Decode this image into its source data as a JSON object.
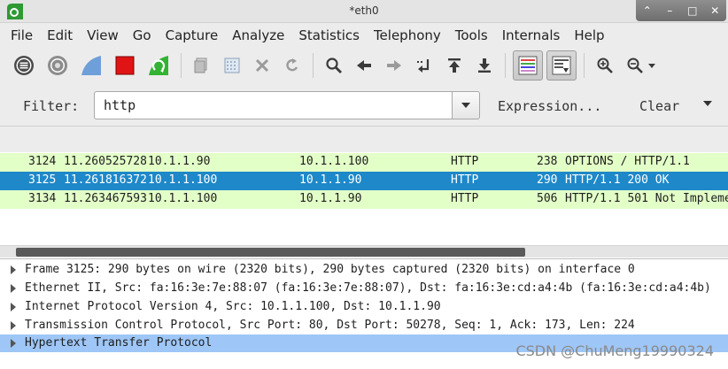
{
  "window": {
    "title": "*eth0",
    "controls": [
      "⌃",
      "–",
      "□",
      "✕"
    ]
  },
  "menu": [
    "File",
    "Edit",
    "View",
    "Go",
    "Capture",
    "Analyze",
    "Statistics",
    "Telephony",
    "Tools",
    "Internals",
    "Help"
  ],
  "toolbar": {
    "icons": [
      "interfaces-icon",
      "capture-options-icon",
      "start-capture-icon",
      "stop-capture-icon",
      "restart-capture-icon",
      "open-file-icon",
      "save-file-icon",
      "close-file-icon",
      "reload-icon",
      "find-packet-icon",
      "go-back-icon",
      "go-forward-icon",
      "go-to-packet-icon",
      "go-to-first-icon",
      "go-to-last-icon",
      "colorize-icon",
      "auto-scroll-icon",
      "zoom-in-icon",
      "zoom-out-icon"
    ]
  },
  "filter": {
    "label": "Filter:",
    "value": "http",
    "expression_label": "Expression...",
    "clear_label": "Clear"
  },
  "packets": [
    {
      "no": "3124",
      "time": "11.260525728",
      "source": "10.1.1.90",
      "destination": "10.1.1.100",
      "protocol": "HTTP",
      "length": "238",
      "info": "OPTIONS / HTTP/1.1"
    },
    {
      "no": "3125",
      "time": "11.261816372",
      "source": "10.1.1.100",
      "destination": "10.1.1.90",
      "protocol": "HTTP",
      "length": "290",
      "info": "HTTP/1.1 200 OK"
    },
    {
      "no": "3134",
      "time": "11.263467593",
      "source": "10.1.1.100",
      "destination": "10.1.1.90",
      "protocol": "HTTP",
      "length": "506",
      "info": "HTTP/1.1 501 Not Impleme"
    }
  ],
  "details": [
    "Frame 3125: 290 bytes on wire (2320 bits), 290 bytes captured (2320 bits) on interface 0",
    "Ethernet II, Src: fa:16:3e:7e:88:07 (fa:16:3e:7e:88:07), Dst: fa:16:3e:cd:a4:4b (fa:16:3e:cd:a4:4b)",
    "Internet Protocol Version 4, Src: 10.1.1.100, Dst: 10.1.1.90",
    "Transmission Control Protocol, Src Port: 80, Dst Port: 50278, Seq: 1, Ack: 173, Len: 224",
    "Hypertext Transfer Protocol"
  ],
  "watermark": "CSDN @ChuMeng19990324",
  "colors": {
    "row_green": "#e3ffc8",
    "row_selected": "#1e88c9",
    "detail_highlight": "#9ec6f6",
    "stop_red": "#e01414",
    "start_blue": "#6f9fd8"
  }
}
